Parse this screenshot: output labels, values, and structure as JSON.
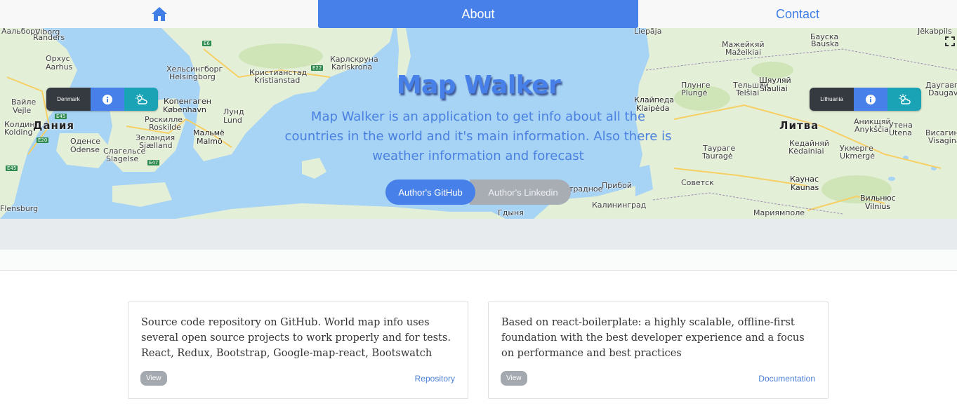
{
  "nav": {
    "home_icon": "home-icon",
    "about_label": "About",
    "contact_label": "Contact"
  },
  "map": {
    "labels": [
      {
        "text": "Viborg"
      },
      {
        "text": "Randers"
      },
      {
        "text": "Орхус"
      },
      {
        "text": "Aarhus"
      },
      {
        "text": "Вайле"
      },
      {
        "text": "Vejle"
      },
      {
        "text": "Колдинг"
      },
      {
        "text": "Kolding"
      },
      {
        "text": "Дания"
      },
      {
        "text": "Оденсе"
      },
      {
        "text": "Odense"
      },
      {
        "text": "Слагельсе"
      },
      {
        "text": "Slagelse"
      },
      {
        "text": "Роскилле"
      },
      {
        "text": "Roskilde"
      },
      {
        "text": "Зеландия"
      },
      {
        "text": "Sjælland"
      },
      {
        "text": "Хельсингборг"
      },
      {
        "text": "Helsingborg"
      },
      {
        "text": "Копенгаген"
      },
      {
        "text": "København"
      },
      {
        "text": "Мальмё"
      },
      {
        "text": "Malmö"
      },
      {
        "text": "Лунд"
      },
      {
        "text": "Lund"
      },
      {
        "text": "Кристианстад"
      },
      {
        "text": "Kristianstad"
      },
      {
        "text": "Карлскруна"
      },
      {
        "text": "Karlskrona"
      },
      {
        "text": "Flensburg"
      },
      {
        "text": "Гдыня"
      },
      {
        "text": "Калининград"
      },
      {
        "text": "Liepāja"
      },
      {
        "text": "Клайпеда"
      },
      {
        "text": "Klaipėda"
      },
      {
        "text": "Плунге"
      },
      {
        "text": "Plungė"
      },
      {
        "text": "Тельшяй"
      },
      {
        "text": "Telšiai"
      },
      {
        "text": "Шяуляй"
      },
      {
        "text": "Šiauliai"
      },
      {
        "text": "Мажейкяй"
      },
      {
        "text": "Mažeikiai"
      },
      {
        "text": "Бауска"
      },
      {
        "text": "Bauska"
      },
      {
        "text": "Даугавп"
      },
      {
        "text": "Daugavp"
      },
      {
        "text": "Литва"
      },
      {
        "text": "Аникщяй"
      },
      {
        "text": "Anykščiai"
      },
      {
        "text": "Утена"
      },
      {
        "text": "Utena"
      },
      {
        "text": "Кедайняй"
      },
      {
        "text": "Kėdainiai"
      },
      {
        "text": "Укмерге"
      },
      {
        "text": "Ukmergė"
      },
      {
        "text": "Таураге"
      },
      {
        "text": "Tauragė"
      },
      {
        "text": "Каунас"
      },
      {
        "text": "Kaunas"
      },
      {
        "text": "Вильнюс"
      },
      {
        "text": "Vilnius"
      },
      {
        "text": "Мариямполе"
      },
      {
        "text": "Висагинас"
      },
      {
        "text": "Visaginas"
      },
      {
        "text": "Jēkabpils"
      },
      {
        "text": "Советск"
      },
      {
        "text": "Прибой"
      },
      {
        "text": "традное"
      },
      {
        "text": "Аальборг"
      }
    ],
    "roads": [
      "E6",
      "E22",
      "E45",
      "E20",
      "E47",
      "E45"
    ]
  },
  "markers": [
    {
      "country": "Denmark",
      "info_icon": "info-icon",
      "weather_icon": "weather-icon"
    },
    {
      "country": "Lithuania",
      "info_icon": "info-icon",
      "weather_icon": "weather-icon"
    }
  ],
  "hero": {
    "title": "Map Walker",
    "description": "Map Walker is an application to get info about all the countries in the world and it's main information. Also there is weather information and forecast",
    "github_button": "Author's GitHub",
    "linkedin_button": "Author's Linkedin"
  },
  "cards": [
    {
      "text": "Source code repository on GitHub. World map info uses several open source projects to work properly and for tests. React, Redux, Bootstrap, Google-map-react, Bootswatch",
      "badge": "View",
      "link": "Repository"
    },
    {
      "text": "Based on react-boilerplate: a highly scalable, offline-first foundation with the best developer experience and a focus on performance and best practices",
      "badge": "View",
      "link": "Documentation"
    }
  ],
  "colors": {
    "primary": "#4680e8",
    "secondary": "#a8adb4",
    "info": "#1aa3b5",
    "dark": "#343a40",
    "water": "#a7d3f5",
    "land": "#e4efd7"
  }
}
